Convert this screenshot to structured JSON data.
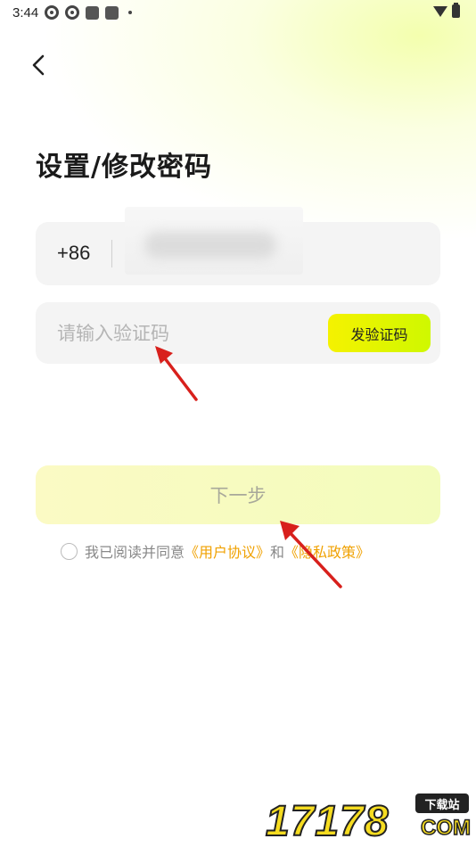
{
  "status_bar": {
    "time": "3:44"
  },
  "page": {
    "title": "设置/修改密码"
  },
  "phone": {
    "country_code": "+86"
  },
  "verify": {
    "placeholder": "请输入验证码",
    "send_label": "发验证码"
  },
  "next_label": "下一步",
  "agreement": {
    "prefix": "我已阅读并同意",
    "user_agreement": "《用户协议》",
    "and": "和",
    "privacy_policy": "《隐私政策》"
  },
  "watermark": {
    "digits": "17178",
    "tag": "下载站",
    "suffix": "COM"
  },
  "colors": {
    "accent_yellow": "#f5f200",
    "link_orange": "#f0a100",
    "arrow_red": "#d8201c"
  },
  "icons": [
    "aperture-icon",
    "aperture-icon",
    "app-square-icon",
    "app-square-icon",
    "wifi-icon",
    "battery-icon",
    "back-chevron-icon",
    "annotation-arrow-icon"
  ]
}
